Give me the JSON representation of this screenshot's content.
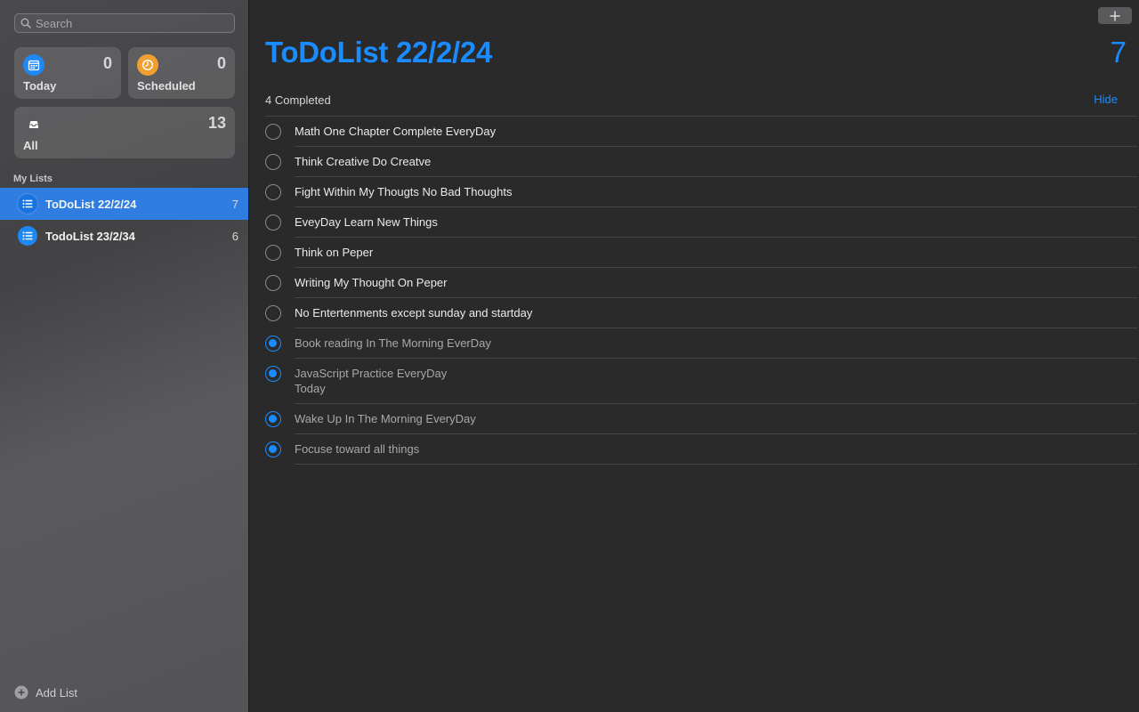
{
  "search": {
    "placeholder": "Search"
  },
  "smart_lists": {
    "today": {
      "label": "Today",
      "count": "0",
      "icon": "calendar-icon",
      "color": "#1e88f5"
    },
    "scheduled": {
      "label": "Scheduled",
      "count": "0",
      "icon": "clock-icon",
      "color": "#f0a030"
    },
    "all": {
      "label": "All",
      "count": "13",
      "icon": "tray-icon",
      "color": "#5c5c5e"
    }
  },
  "my_lists": {
    "header": "My Lists",
    "items": [
      {
        "name": "ToDoList 22/2/24",
        "count": "7",
        "selected": true,
        "icon": "list-icon"
      },
      {
        "name": "TodoList 23/2/34",
        "count": "6",
        "selected": false,
        "icon": "list-icon"
      }
    ]
  },
  "add_list": {
    "label": "Add List",
    "icon": "plus-circle-icon"
  },
  "main": {
    "title": "ToDoList 22/2/24",
    "count": "7",
    "completed_label": "4 Completed",
    "hide_label": "Hide",
    "accent": "#1a8cff",
    "add_icon": "plus-icon"
  },
  "tasks": [
    {
      "title": "Math One Chapter Complete EveryDay",
      "done": false
    },
    {
      "title": "Think Creative Do Creatve",
      "done": false
    },
    {
      "title": "Fight Within My Thougts No Bad Thoughts",
      "done": false
    },
    {
      "title": "EveyDay Learn New Things",
      "done": false
    },
    {
      "title": "Think on Peper",
      "done": false
    },
    {
      "title": "Writing My Thought On Peper",
      "done": false
    },
    {
      "title": "No Entertenments except sunday and startday",
      "done": false
    },
    {
      "title": "Book reading In The Morning EverDay",
      "done": true
    },
    {
      "title": "JavaScript Practice EveryDay",
      "subtitle": "Today",
      "done": true
    },
    {
      "title": "Wake Up In The Morning EveryDay",
      "done": true
    },
    {
      "title": "Focuse toward all things",
      "done": true
    }
  ]
}
